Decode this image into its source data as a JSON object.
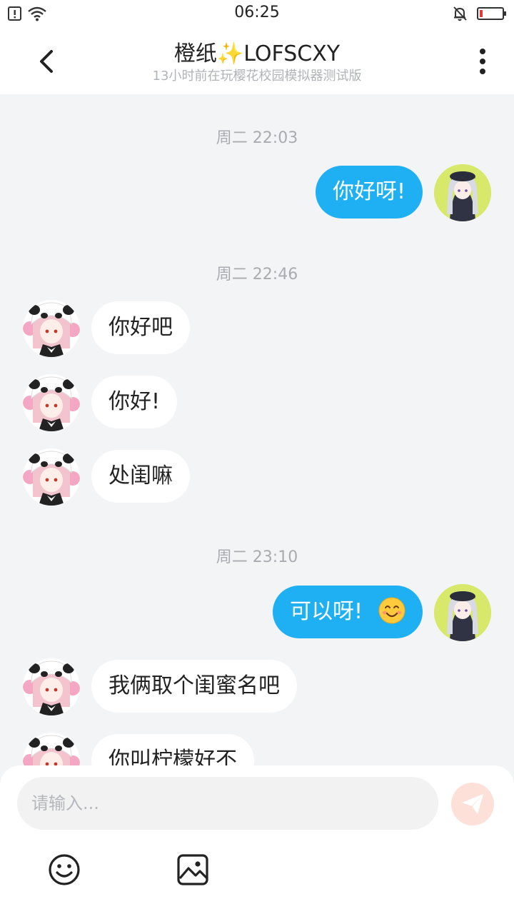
{
  "status_bar": {
    "time": "06:25",
    "icons": [
      "alert-sim-icon",
      "wifi-icon",
      "bell-muted-icon",
      "battery-low-icon"
    ]
  },
  "header": {
    "title": "橙纸✨LOFSCXY",
    "subtitle": "13小时前在玩樱花校园模拟器测试版",
    "back_icon": "chevron-left-icon",
    "more_icon": "more-vertical-icon"
  },
  "chat": {
    "time_labels": [
      "周二 22:03",
      "周二 22:46",
      "周二 23:10"
    ],
    "messages": [
      {
        "side": "out",
        "text": "你好呀!"
      },
      {
        "side": "in",
        "text": "你好吧"
      },
      {
        "side": "in",
        "text": "你好!"
      },
      {
        "side": "in",
        "text": "处闺嘛"
      },
      {
        "side": "out",
        "text": "可以呀!",
        "emoji": "smiling-face-emoji"
      },
      {
        "side": "in",
        "text": "我俩取个闺蜜名吧"
      },
      {
        "side": "in",
        "text": "你叫柠檬好不"
      }
    ]
  },
  "composer": {
    "input_value": "",
    "placeholder": "请输入...",
    "send_icon": "send-icon",
    "emoji_icon": "smiley-icon",
    "image_icon": "image-icon"
  },
  "colors": {
    "accent": "#1eb0f2",
    "background": "#f3f4f6",
    "send_button": "#fde1d9",
    "right_avatar_bg": "#d8e86a"
  }
}
